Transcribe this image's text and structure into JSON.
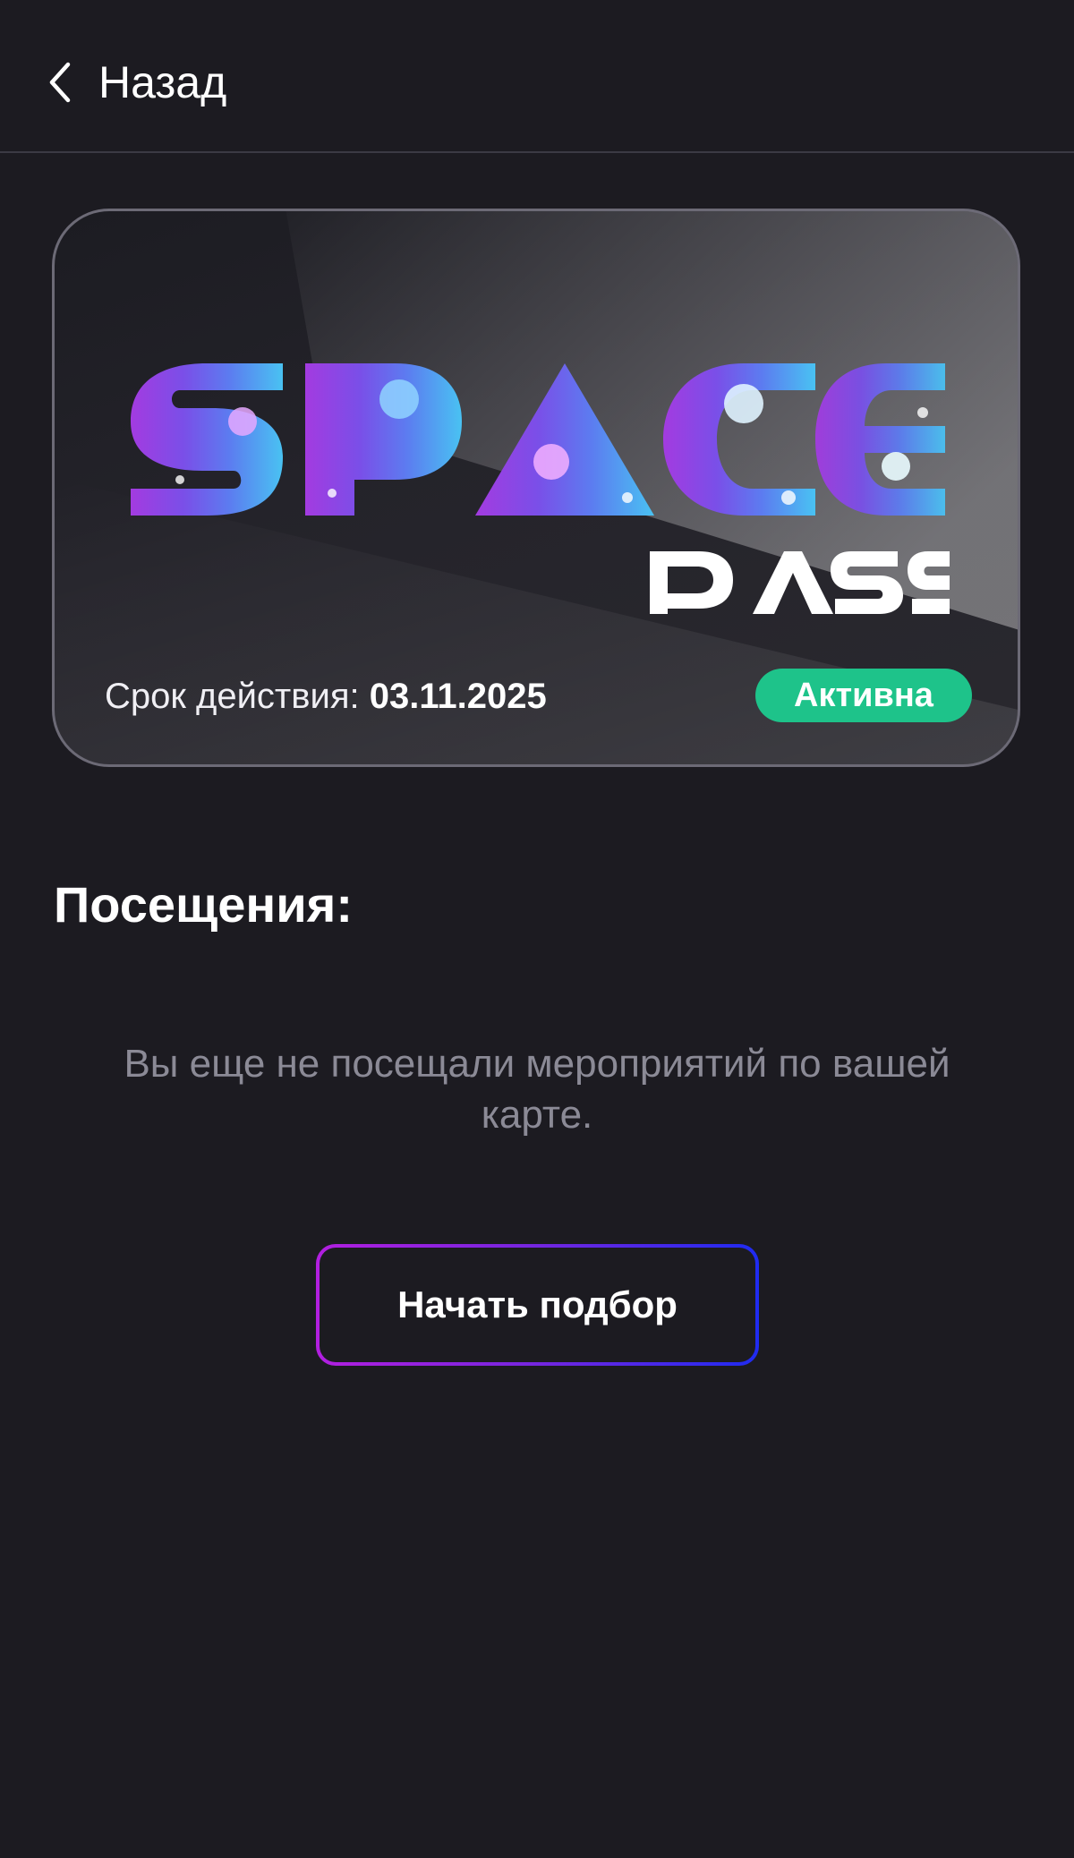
{
  "header": {
    "back_label": "Назад",
    "back_icon": "chevron-left-icon"
  },
  "card": {
    "logo_text": "SPACE",
    "logo_subtext": "PASS",
    "validity_label": "Срок действия:",
    "validity_date": "03.11.2025",
    "status_label": "Активна"
  },
  "visits": {
    "title": "Посещения:",
    "empty_message": "Вы еще не посещали мероприятий по вашей карте."
  },
  "action": {
    "start_label": "Начать подбор"
  },
  "colors": {
    "background": "#1c1b21",
    "status_green": "#1ec38a",
    "button_gradient_start": "#b21fe0",
    "button_gradient_end": "#1f2bf0",
    "muted_text": "#8b8a96"
  }
}
